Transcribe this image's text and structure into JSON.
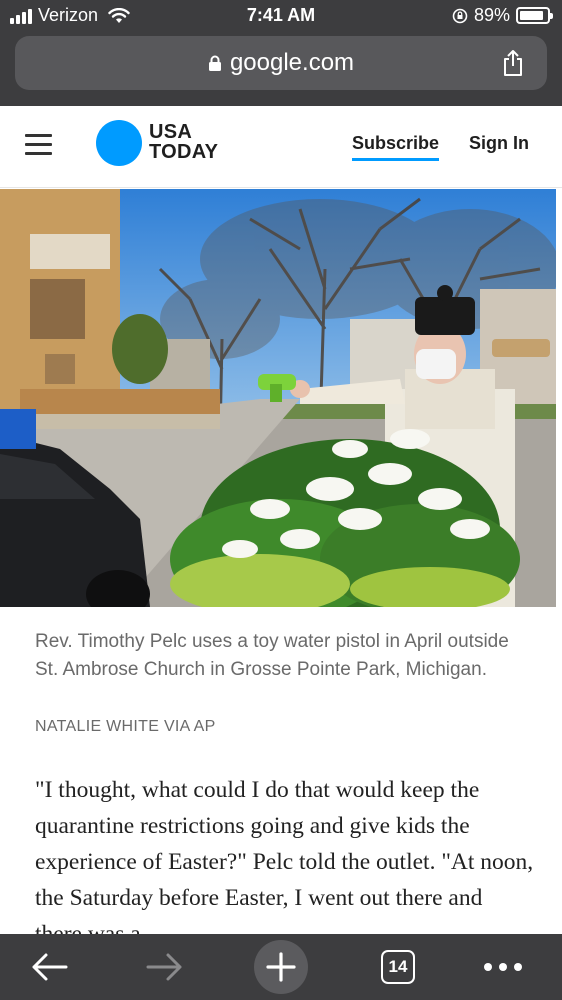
{
  "status_bar": {
    "carrier": "Verizon",
    "time": "7:41 AM",
    "battery": "89%",
    "battery_level": 0.89
  },
  "browser": {
    "url": "google.com",
    "tab_count": "14"
  },
  "header": {
    "logo_line1": "USA",
    "logo_line2": "TODAY",
    "subscribe": "Subscribe",
    "sign_in": "Sign In"
  },
  "article": {
    "caption": "Rev. Timothy Pelc uses a toy water pistol in April outside St. Ambrose Church in Grosse Pointe Park, Michigan.",
    "credit": "NATALIE WHITE VIA AP",
    "paragraph": "\"I thought, what could I do that would keep the quarantine restrictions going and give kids the experience of Easter?\" Pelc told the outlet. \"At noon, the Saturday before Easter, I went out there and there was a"
  },
  "colors": {
    "browser_chrome": "#3d3d3f",
    "brand_blue": "#009bff"
  }
}
